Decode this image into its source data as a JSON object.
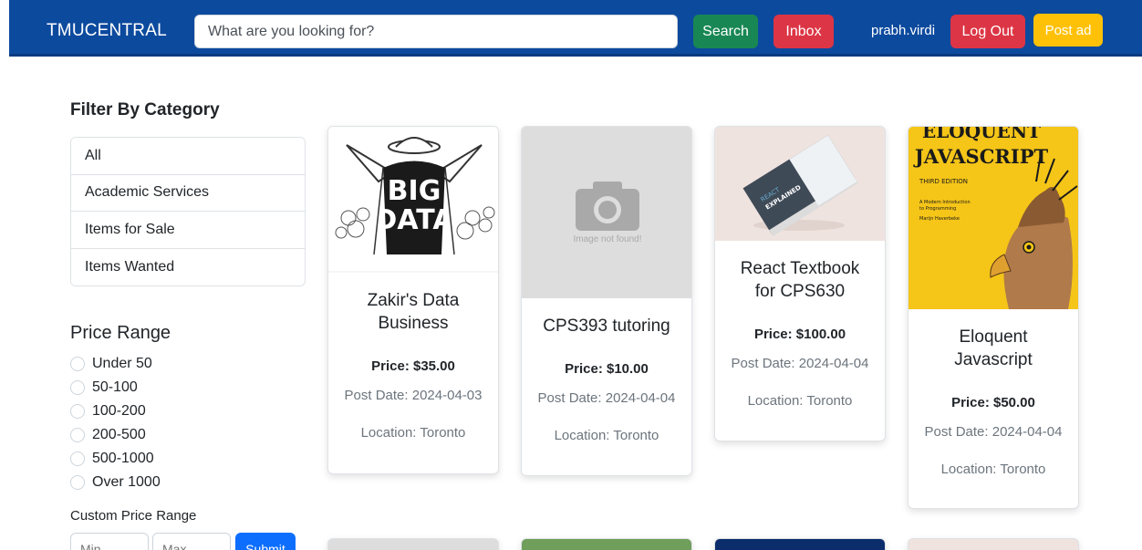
{
  "header": {
    "brand": "TMUCENTRAL",
    "search_placeholder": "What are you looking for?",
    "search_button": "Search",
    "inbox_button": "Inbox",
    "username": "prabh.virdi",
    "logout_button": "Log Out",
    "post_ad_button": "Post ad"
  },
  "sidebar": {
    "filter_title": "Filter By Category",
    "categories": [
      "All",
      "Academic Services",
      "Items for Sale",
      "Items Wanted"
    ],
    "price_title": "Price Range",
    "price_ranges": [
      "Under 50",
      "50-100",
      "100-200",
      "200-500",
      "500-1000",
      "Over 1000"
    ],
    "custom_label": "Custom Price Range",
    "min_placeholder": "Min",
    "max_placeholder": "Max",
    "submit_button": "Submit"
  },
  "listings": [
    {
      "title": "Zakir's Data Business",
      "price": "Price: $35.00",
      "date": "Post Date: 2024-04-03",
      "location": "Location: Toronto",
      "image": "big-data-cartoon"
    },
    {
      "title": "CPS393 tutoring",
      "price": "Price: $10.00",
      "date": "Post Date: 2024-04-04",
      "location": "Location: Toronto",
      "image": "placeholder",
      "image_text": "Image not found!"
    },
    {
      "title": "React Textbook for CPS630",
      "price": "Price: $100.00",
      "date": "Post Date: 2024-04-04",
      "location": "Location: Toronto",
      "image": "react-book",
      "image_text": "REACT EXPLAINED"
    },
    {
      "title": "Eloquent Javascript",
      "price": "Price: $50.00",
      "date": "Post Date: 2024-04-04",
      "location": "Location: Toronto",
      "image": "eloquent-js-cover",
      "image_text": [
        "ELOQUENT",
        "JAVASCRIPT",
        "THIRD EDITION",
        "A Modern Introduction to Programming",
        "Marijn Haverbeke"
      ]
    }
  ],
  "colors": {
    "navbar": "#0c4a9e",
    "search": "#198754",
    "danger": "#dc3545",
    "warning": "#ffc107",
    "primary": "#0d6efd"
  }
}
